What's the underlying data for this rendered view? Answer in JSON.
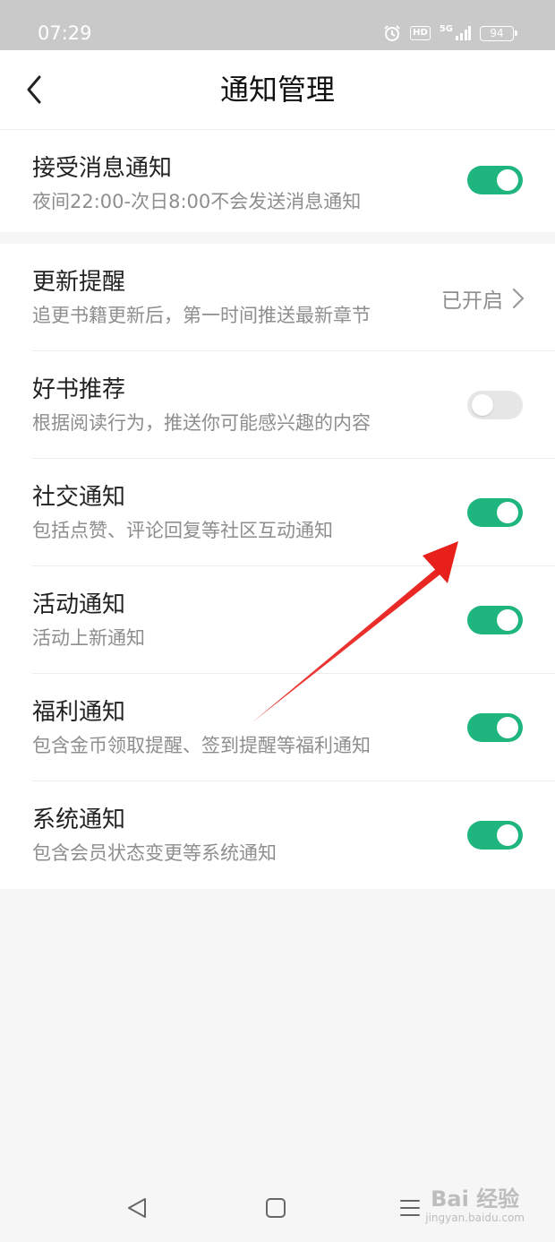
{
  "status_bar": {
    "time": "07:29",
    "network": "5G",
    "hd": "HD",
    "battery": "94",
    "icons": [
      "alarm-icon",
      "hd-icon",
      "signal-5g-icon",
      "battery-icon"
    ]
  },
  "header": {
    "title": "通知管理",
    "back_icon": "chevron-left-icon"
  },
  "master": {
    "title": "接受消息通知",
    "subtitle": "夜间22:00-次日8:00不会发送消息通知",
    "enabled": true
  },
  "settings": [
    {
      "title": "更新提醒",
      "subtitle": "追更书籍更新后，第一时间推送最新章节",
      "type": "link",
      "value": "已开启"
    },
    {
      "title": "好书推荐",
      "subtitle": "根据阅读行为，推送你可能感兴趣的内容",
      "type": "toggle",
      "enabled": false
    },
    {
      "title": "社交通知",
      "subtitle": "包括点赞、评论回复等社区互动通知",
      "type": "toggle",
      "enabled": true
    },
    {
      "title": "活动通知",
      "subtitle": "活动上新通知",
      "type": "toggle",
      "enabled": true
    },
    {
      "title": "福利通知",
      "subtitle": "包含金币领取提醒、签到提醒等福利通知",
      "type": "toggle",
      "enabled": true
    },
    {
      "title": "系统通知",
      "subtitle": "包含会员状态变更等系统通知",
      "type": "toggle",
      "enabled": true
    }
  ],
  "colors": {
    "toggle_on": "#1fb57f",
    "toggle_off": "#e6e6e6",
    "annotation_arrow": "#e8201c"
  },
  "system_nav": {
    "icons": [
      "back-triangle-icon",
      "home-square-icon",
      "menu-lines-icon"
    ]
  },
  "watermark": {
    "main": "Bai 经验",
    "sub": "jingyan.baidu.com"
  }
}
